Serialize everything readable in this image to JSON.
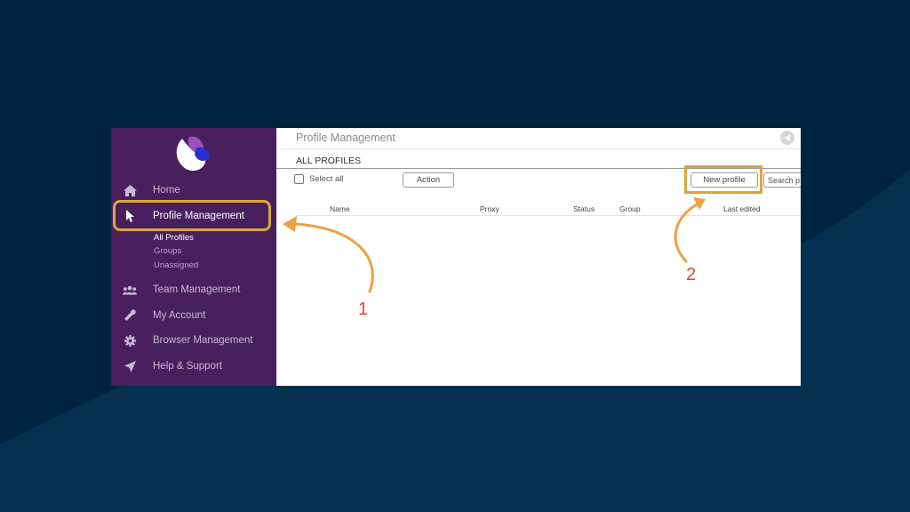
{
  "colors": {
    "background": "#022340",
    "sidebar": "#4a1f5e",
    "highlight": "#d8a83d",
    "arrow": "#efa043",
    "annotation_number": "#e0452b"
  },
  "sidebar": {
    "logo": "logo-icon",
    "items": [
      {
        "label": "Home",
        "icon": "home-icon"
      },
      {
        "label": "Profile Management",
        "icon": "cursor-icon",
        "active": true
      },
      {
        "label": "Team Management",
        "icon": "users-icon"
      },
      {
        "label": "My Account",
        "icon": "wrench-icon"
      },
      {
        "label": "Browser Management",
        "icon": "gear-icon"
      },
      {
        "label": "Help & Support",
        "icon": "send-icon"
      }
    ],
    "subitems": [
      {
        "label": "All Profiles",
        "active": true
      },
      {
        "label": "Groups"
      },
      {
        "label": "Unassigned"
      }
    ]
  },
  "main": {
    "page_title": "Profile Management",
    "section_title": "ALL PROFILES",
    "select_all_label": "Select all",
    "action_button": "Action",
    "new_profile_button": "New profile",
    "search_placeholder": "Search p",
    "columns": [
      "Name",
      "Proxy",
      "Status",
      "Group",
      "Last edited"
    ]
  },
  "annotations": {
    "label_1": "1",
    "label_2": "2"
  }
}
